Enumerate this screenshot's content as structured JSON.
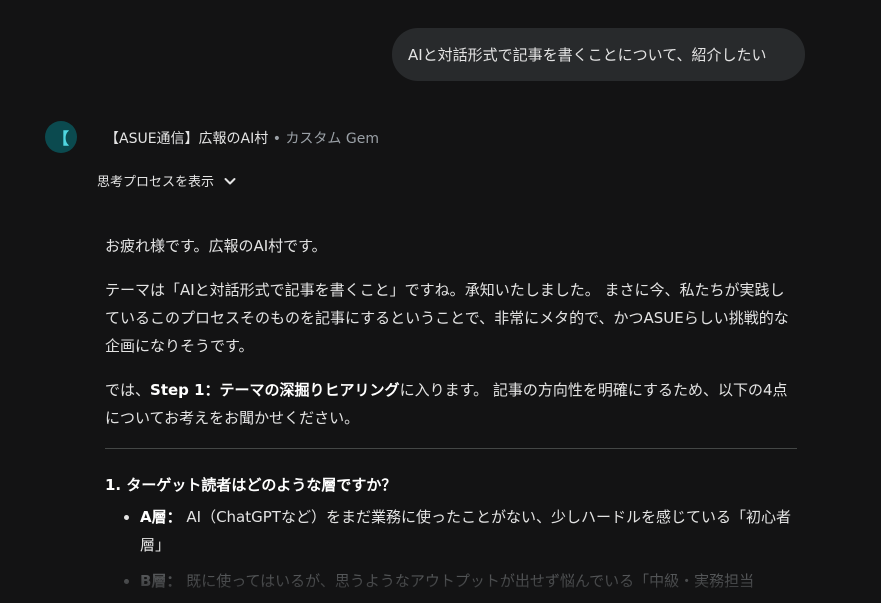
{
  "user_message": "AIと対話形式で記事を書くことについて、紹介したい",
  "gem": {
    "avatar_glyph": "【",
    "name": "【ASUE通信】広報のAI村",
    "separator": " • ",
    "type": "カスタム Gem"
  },
  "thinking_toggle": {
    "label": "思考プロセスを表示",
    "icon": "chevron-down-icon"
  },
  "response": {
    "greeting": "お疲れ様です。広報のAI村です。",
    "intro": "テーマは「AIと対話形式で記事を書くこと」ですね。承知いたしました。 まさに今、私たちが実践しているこのプロセスそのものを記事にするということで、非常にメタ的で、かつASUEらしい挑戦的な企画になりそうです。",
    "step_prefix": "では、",
    "step_bold": "Step 1：テーマの深掘りヒアリング",
    "step_suffix": "に入ります。 記事の方向性を明確にするため、以下の4点についてお考えをお聞かせください。",
    "question_1": "1. ターゲット読者はどのような層ですか？",
    "options": [
      {
        "label": "A層：",
        "text": " AI（ChatGPTなど）をまだ業務に使ったことがない、少しハードルを感じている「初心者層」"
      },
      {
        "label": "B層：",
        "text": " 既に使ってはいるが、思うようなアウトプットが出せず悩んでいる「中級・実務担当"
      }
    ]
  },
  "colors": {
    "background": "#131314",
    "bubble": "#282a2c",
    "avatar_bg": "#0b4a4f",
    "avatar_fg": "#4fd6e0"
  }
}
